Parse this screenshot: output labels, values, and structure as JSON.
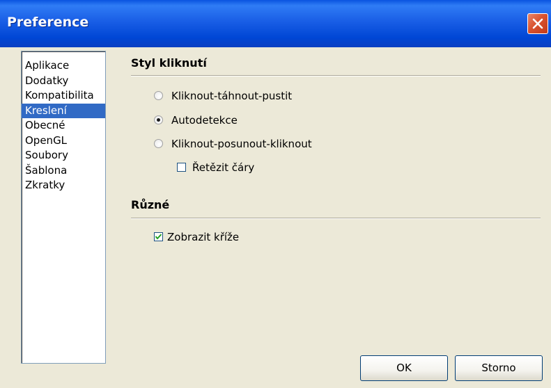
{
  "window": {
    "title": "Preference"
  },
  "sidebar": {
    "items": [
      {
        "label": "Aplikace",
        "selected": false
      },
      {
        "label": "Dodatky",
        "selected": false
      },
      {
        "label": "Kompatibilita",
        "selected": false
      },
      {
        "label": "Kreslení",
        "selected": true
      },
      {
        "label": "Obecné",
        "selected": false
      },
      {
        "label": "OpenGL",
        "selected": false
      },
      {
        "label": "Soubory",
        "selected": false
      },
      {
        "label": "Šablona",
        "selected": false
      },
      {
        "label": "Zkratky",
        "selected": false
      }
    ]
  },
  "click_style": {
    "title": "Styl kliknutí",
    "options": [
      {
        "label": "Kliknout-táhnout-pustit",
        "checked": false
      },
      {
        "label": "Autodetekce",
        "checked": true
      },
      {
        "label": "Kliknout-posunout-kliknout",
        "checked": false
      }
    ],
    "chain_lines": {
      "label": "Řetězit čáry",
      "checked": false
    }
  },
  "misc": {
    "title": "Různé",
    "show_crosses": {
      "label": "Zobrazit kříže",
      "checked": true
    }
  },
  "buttons": {
    "ok": "OK",
    "cancel": "Storno"
  },
  "colors": {
    "titlebar": "#0a53e0",
    "selection": "#316ac5",
    "face": "#ece9d8",
    "close": "#d9532f"
  }
}
